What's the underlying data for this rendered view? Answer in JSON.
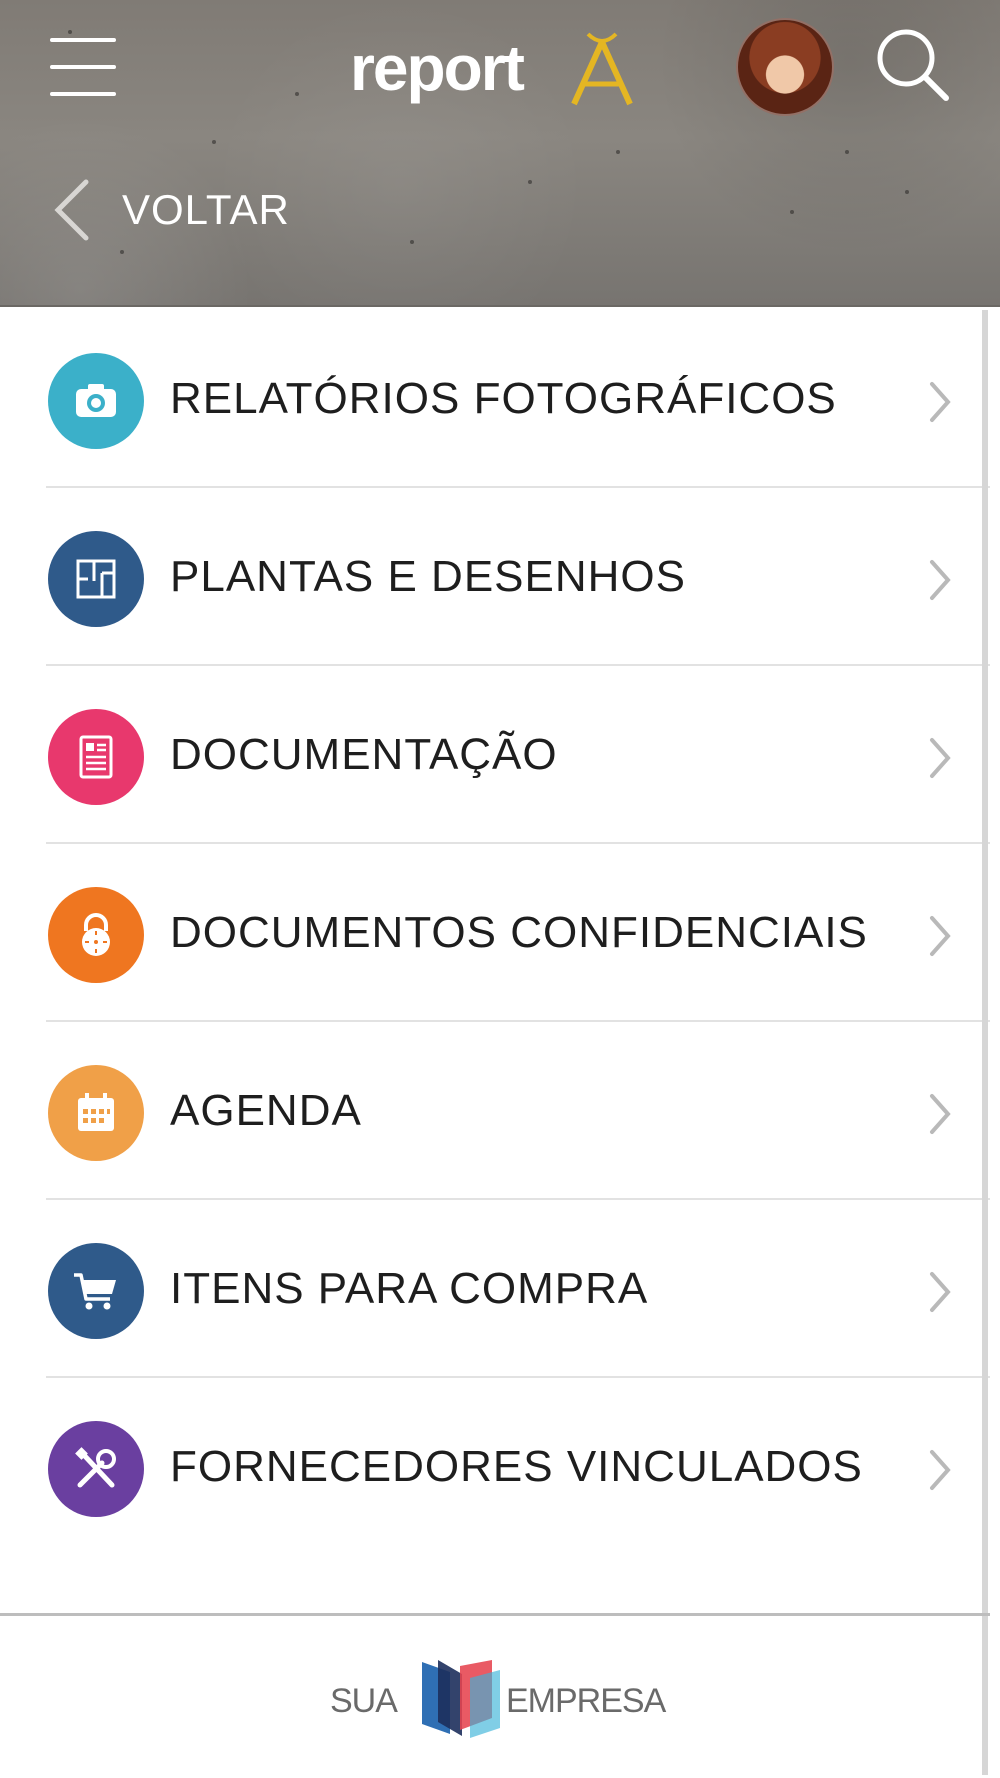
{
  "header": {
    "logo_text": "report",
    "back_label": "VOLTAR",
    "icons": {
      "menu": "hamburger-menu-icon",
      "search": "search-icon",
      "back": "chevron-left-icon"
    },
    "colors": {
      "logo_accent": "#e4b623"
    }
  },
  "menu": {
    "items": [
      {
        "label": "RELATÓRIOS FOTOGRÁFICOS",
        "icon": "camera-icon",
        "color": "#3bb0c9"
      },
      {
        "label": "PLANTAS E DESENHOS",
        "icon": "floorplan-icon",
        "color": "#2f5a8a"
      },
      {
        "label": "DOCUMENTAÇÃO",
        "icon": "document-icon",
        "color": "#e8386d"
      },
      {
        "label": "DOCUMENTOS CONFIDENCIAIS",
        "icon": "lock-icon",
        "color": "#ef7620"
      },
      {
        "label": "AGENDA",
        "icon": "calendar-icon",
        "color": "#f0a048"
      },
      {
        "label": "ITENS PARA COMPRA",
        "icon": "cart-icon",
        "color": "#2f5a8a"
      },
      {
        "label": "FORNECEDORES VINCULADOS",
        "icon": "tools-icon",
        "color": "#6a3fa0"
      }
    ]
  },
  "footer": {
    "left_text": "SUA",
    "right_text": "EMPRESA"
  }
}
